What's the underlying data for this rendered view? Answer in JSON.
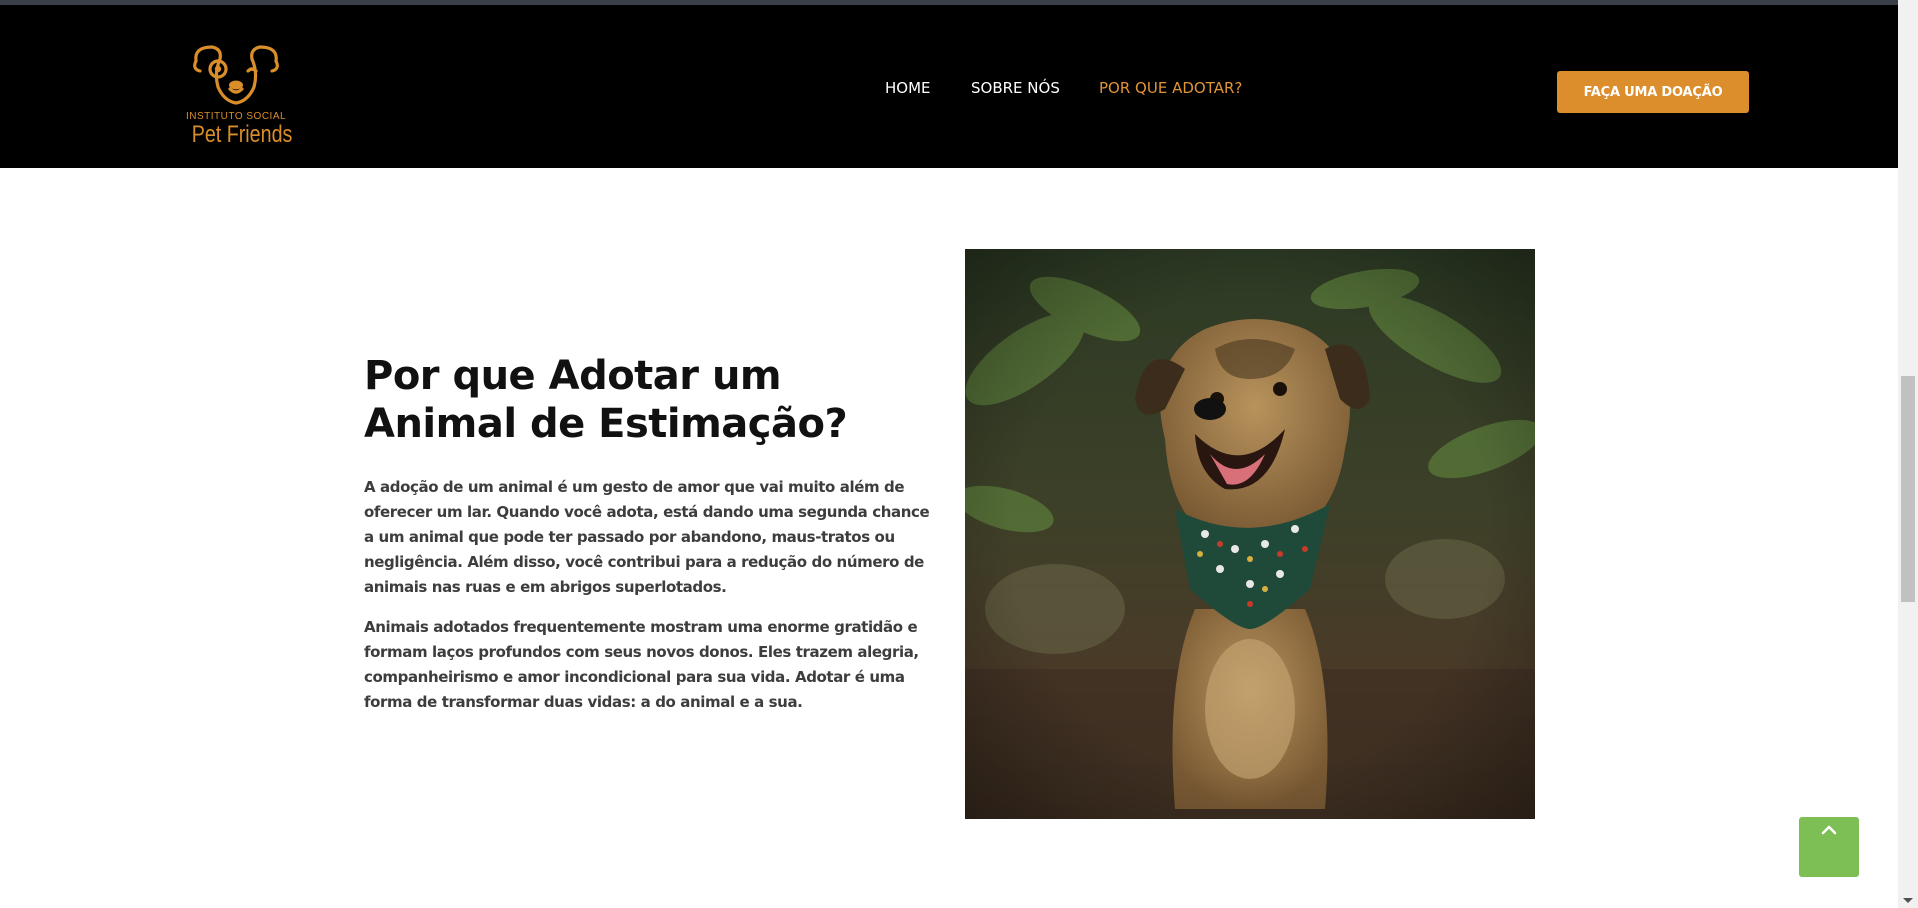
{
  "header": {
    "logo": {
      "small_text": "INSTITUTO SOCIAL",
      "big_text": "Pet Friends",
      "icon": "dog-face-icon"
    },
    "nav": [
      {
        "label": "HOME",
        "active": false
      },
      {
        "label": "SOBRE NÓS",
        "active": false
      },
      {
        "label": "POR QUE ADOTAR?",
        "active": true
      }
    ],
    "donate_label": "FAÇA UMA DOAÇÃO"
  },
  "main": {
    "title": "Por que Adotar um Animal de Estimação?",
    "paragraphs": [
      "A adoção de um animal é um gesto de amor que vai muito além de oferecer um lar. Quando você adota, está dando uma segunda chance a um animal que pode ter passado por abandono, maus-tratos ou negligência. Além disso, você contribui para a redução do número de animais nas ruas e em abrigos superlotados.",
      "Animais adotados frequentemente mostram uma enorme gratidão e formam laços profundos com seus novos donos. Eles trazem alegria, companheirismo e amor incondicional para sua vida. Adotar é uma forma de transformar duas vidas: a do animal e a sua."
    ],
    "photo": "dog-with-bandana-photo"
  },
  "back_to_top_icon": "chevron-up-icon",
  "colors": {
    "header_bg": "#000000",
    "accent": "#dd8e2c",
    "active_nav": "#e09438",
    "back_to_top": "#7dbf55",
    "title": "#111111",
    "body_text": "#3d3d3d"
  }
}
